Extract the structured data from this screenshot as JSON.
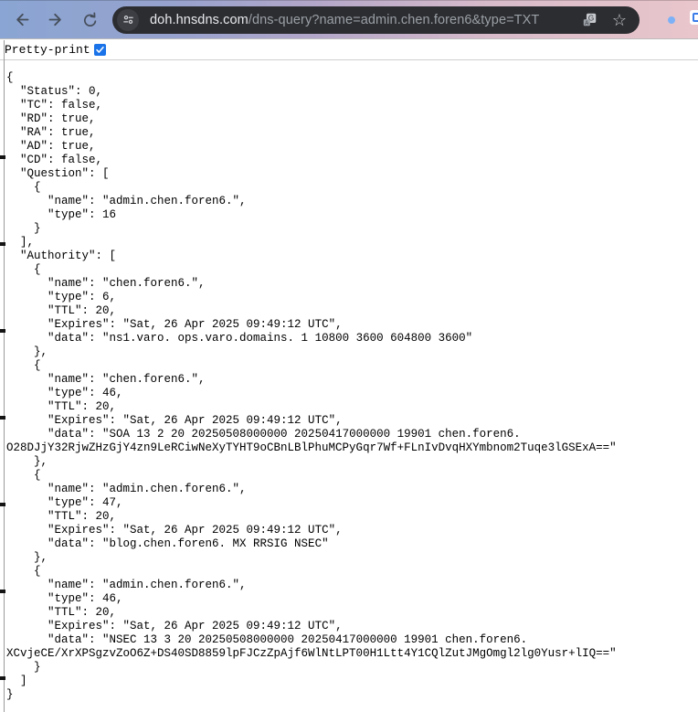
{
  "browser": {
    "url_domain": "doh.hnsdns.com",
    "url_path": "/dns-query?name=admin.chen.foren6&type=TXT"
  },
  "icons": {
    "back": "back-arrow",
    "forward": "forward-arrow",
    "reload": "reload-circular-arrow",
    "site_settings": "tune-sliders",
    "translate": "translate-badge",
    "bookmark": "☆",
    "profile": "blue-ring-avatar",
    "extension_partial": "white-square-blue-inset"
  },
  "colors": {
    "accent_blue": "#1a73e8",
    "omnibox_bg": "#2c2d31",
    "toolbar_gradient_left": "#8aa5d3",
    "toolbar_gradient_right": "#e9c6cb",
    "url_domain_text": "#e9eaed",
    "url_path_text": "#9aa0a6",
    "profile_ring": "#7db1f7"
  },
  "pretty_print": {
    "label": "Pretty-print",
    "checked": true
  },
  "json_viewer": {
    "lines": [
      "{",
      "  \"Status\": 0,",
      "  \"TC\": false,",
      "  \"RD\": true,",
      "  \"RA\": true,",
      "  \"AD\": true,",
      "  \"CD\": false,",
      "  \"Question\": [",
      "    {",
      "      \"name\": \"admin.chen.foren6.\",",
      "      \"type\": 16",
      "    }",
      "  ],",
      "  \"Authority\": [",
      "    {",
      "      \"name\": \"chen.foren6.\",",
      "      \"type\": 6,",
      "      \"TTL\": 20,",
      "      \"Expires\": \"Sat, 26 Apr 2025 09:49:12 UTC\",",
      "      \"data\": \"ns1.varo. ops.varo.domains. 1 10800 3600 604800 3600\"",
      "    },",
      "    {",
      "      \"name\": \"chen.foren6.\",",
      "      \"type\": 46,",
      "      \"TTL\": 20,",
      "      \"Expires\": \"Sat, 26 Apr 2025 09:49:12 UTC\",",
      "      \"data\": \"SOA 13 2 20 20250508000000 20250417000000 19901 chen.foren6. O28DJjY32RjwZHzGjY4zn9LeRCiwNeXyTYHT9oCBnLBlPhuMCPyGqr7Wf+FLnIvDvqHXYmbnom2Tuqe3lGSExA==\"",
      "    },",
      "    {",
      "      \"name\": \"admin.chen.foren6.\",",
      "      \"type\": 47,",
      "      \"TTL\": 20,",
      "      \"Expires\": \"Sat, 26 Apr 2025 09:49:12 UTC\",",
      "      \"data\": \"blog.chen.foren6. MX RRSIG NSEC\"",
      "    },",
      "    {",
      "      \"name\": \"admin.chen.foren6.\",",
      "      \"type\": 46,",
      "      \"TTL\": 20,",
      "      \"Expires\": \"Sat, 26 Apr 2025 09:49:12 UTC\",",
      "      \"data\": \"NSEC 13 3 20 20250508000000 20250417000000 19901 chen.foren6. XCvjeCE/XrXPSgzvZoO6Z+DS40SD8859lpFJCzZpAjf6WlNtLPT00H1Ltt4Y1CQlZutJMgOmgl2lg0Yusr+lIQ==\"",
      "    }",
      "  ]",
      "}"
    ]
  }
}
